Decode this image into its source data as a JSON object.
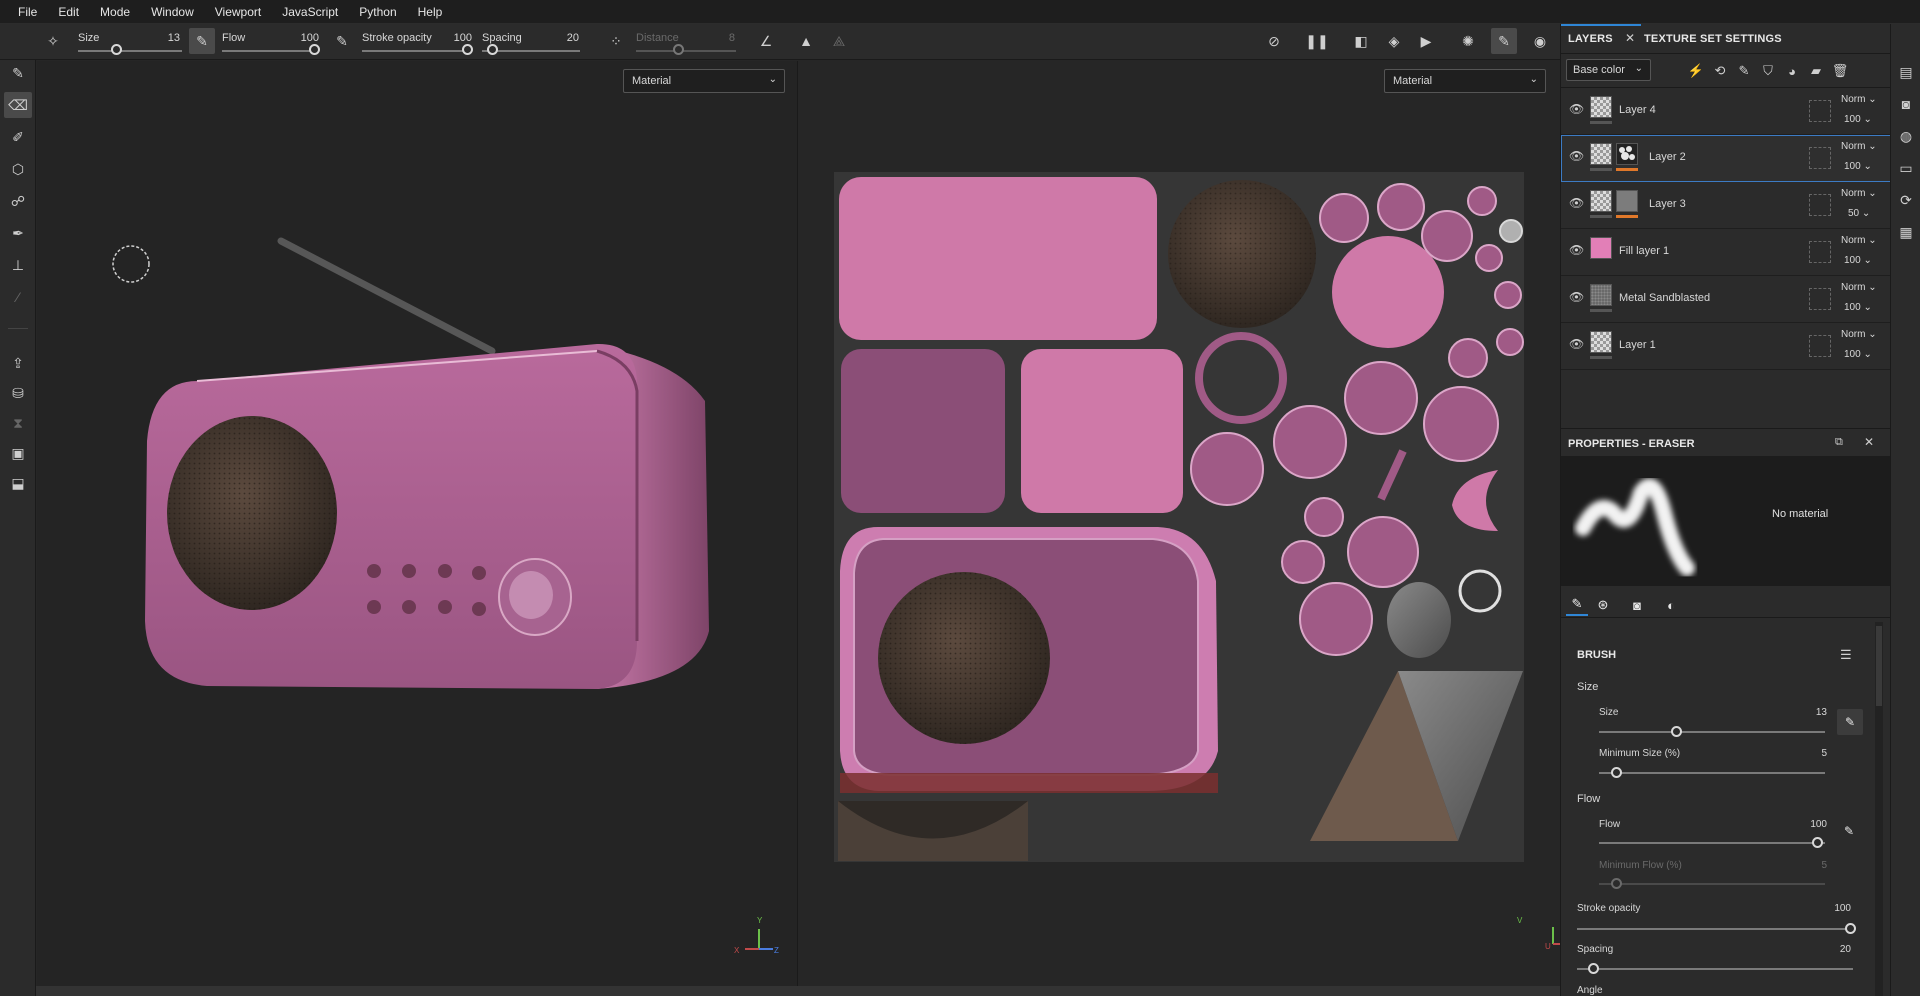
{
  "menu": [
    "File",
    "Edit",
    "Mode",
    "Window",
    "Viewport",
    "JavaScript",
    "Python",
    "Help"
  ],
  "options_bar": {
    "size": {
      "label": "Size",
      "value": "13"
    },
    "flow": {
      "label": "Flow",
      "value": "100"
    },
    "stroke_opacity": {
      "label": "Stroke opacity",
      "value": "100"
    },
    "spacing": {
      "label": "Spacing",
      "value": "20"
    },
    "distance": {
      "label": "Distance",
      "value": "8"
    }
  },
  "viewport_3d": {
    "channel": "Material"
  },
  "viewport_2d": {
    "channel": "Material"
  },
  "panel_tabs": {
    "layers": "LAYERS",
    "texture_set": "TEXTURE SET SETTINGS"
  },
  "layers_channel": "Base color",
  "layers": [
    {
      "name": "Layer 4",
      "blend": "Norm",
      "opacity": "100"
    },
    {
      "name": "Layer 2",
      "blend": "Norm",
      "opacity": "100"
    },
    {
      "name": "Layer 3",
      "blend": "Norm",
      "opacity": "50"
    },
    {
      "name": "Fill layer 1",
      "blend": "Norm",
      "opacity": "100"
    },
    {
      "name": "Metal Sandblasted",
      "blend": "Norm",
      "opacity": "100"
    },
    {
      "name": "Layer 1",
      "blend": "Norm",
      "opacity": "100"
    }
  ],
  "properties": {
    "title": "PROPERTIES - ERASER",
    "no_material": "No material",
    "brush_title": "BRUSH",
    "size_group": "Size",
    "size_label": "Size",
    "size_value": "13",
    "min_size_label": "Minimum Size (%)",
    "min_size_value": "5",
    "flow_group": "Flow",
    "flow_label": "Flow",
    "flow_value": "100",
    "min_flow_label": "Minimum Flow (%)",
    "min_flow_value": "5",
    "stroke_opacity_label": "Stroke opacity",
    "stroke_opacity_value": "100",
    "spacing_label": "Spacing",
    "spacing_value": "20",
    "angle_label": "Angle"
  },
  "axis_3d": {
    "y": "Y",
    "x": "X",
    "z": "Z"
  },
  "axis_2d": {
    "v": "V",
    "u": "U"
  },
  "colors": {
    "accent": "#2f86d6",
    "pink": "#c96fa0",
    "layer_mark": "#e0782a"
  }
}
